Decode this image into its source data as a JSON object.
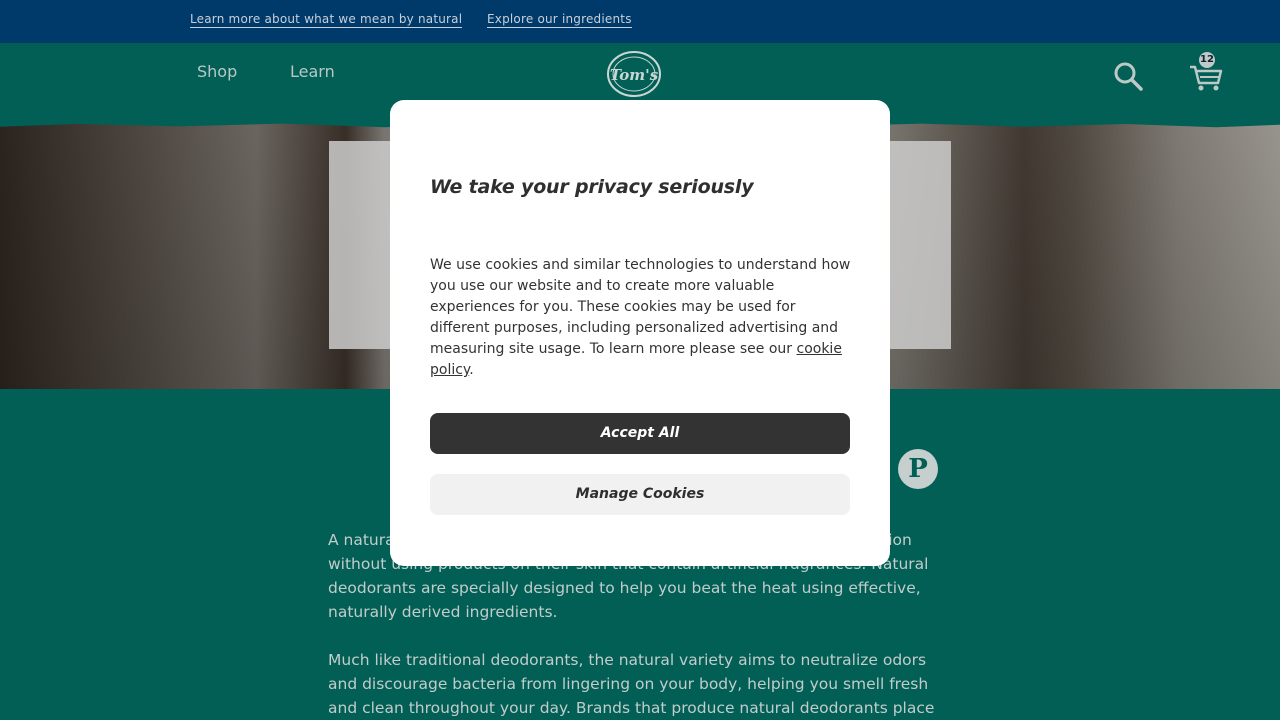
{
  "topbar": {
    "link1": "Learn more about what we mean by natural",
    "link2": "Explore our ingredients"
  },
  "header": {
    "nav": [
      "Shop",
      "Learn"
    ],
    "logo_text": "Tom's",
    "cart_count": "12",
    "icons": [
      "search-icon",
      "cart-icon"
    ]
  },
  "article": {
    "social_icon": "pinterest-icon",
    "paragraph1": "A natural deodorant is a popular option for those who want odor protection without using products on their skin that contain artificial fragrances. Natural deodorants are specially designed to help you beat the heat using effective, naturally derived ingredients.",
    "paragraph2": "Much like traditional deodorants, the natural variety aims to neutralize odors and discourage bacteria from lingering on your body, helping you smell fresh and clean throughout your day. Brands that produce natural deodorants place"
  },
  "cookie_modal": {
    "title": "We take your privacy seriously",
    "body": "We use cookies and similar technologies to understand how you use our website and to create more valuable experiences for you. These cookies may be used for different purposes, including personalized advertising and measuring site usage. To learn more please see our ",
    "policy_link": "cookie policy",
    "body_end": ".",
    "accept_label": "Accept All",
    "manage_label": "Manage Cookies"
  },
  "colors": {
    "topbar": "#003a6b",
    "header": "#015f55",
    "accept_button": "#333333"
  }
}
